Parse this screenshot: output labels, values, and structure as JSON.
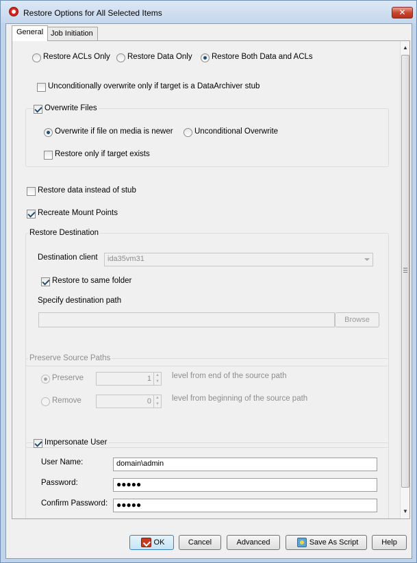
{
  "window": {
    "title": "Restore Options for All Selected Items",
    "close_glyph": "✕"
  },
  "tabs": [
    {
      "label": "General",
      "active": true
    },
    {
      "label": "Job Initiation",
      "active": false
    }
  ],
  "restore_mode": {
    "options": [
      "Restore ACLs Only",
      "Restore Data Only",
      "Restore Both Data and ACLs"
    ],
    "selected": "Restore Both Data and ACLs"
  },
  "unconditional_stub": {
    "label": "Unconditionally overwrite only if target is a DataArchiver stub",
    "checked": false
  },
  "overwrite_files": {
    "label": "Overwrite Files",
    "checked": true,
    "options": [
      "Overwrite if file on media is newer",
      "Unconditional Overwrite"
    ],
    "selected": "Overwrite if file on media is newer",
    "restore_if_exists": {
      "label": "Restore only if target exists",
      "checked": false
    }
  },
  "restore_data_instead_of_stub": {
    "label": "Restore data instead of stub",
    "checked": false
  },
  "recreate_mount_points": {
    "label": "Recreate Mount Points",
    "checked": true
  },
  "destination": {
    "group_label": "Restore Destination",
    "client_label": "Destination client",
    "client_value": "ida35vm31",
    "same_folder": {
      "label": "Restore to same folder",
      "checked": true
    },
    "path_label": "Specify destination path",
    "path_value": "",
    "browse_label": "Browse"
  },
  "preserve_paths": {
    "group_label": "Preserve Source Paths",
    "preserve": {
      "label": "Preserve",
      "value": "1",
      "desc": "level from end of the source path",
      "selected": true
    },
    "remove": {
      "label": "Remove",
      "value": "0",
      "desc": "level from beginning of the source path",
      "selected": false
    }
  },
  "impersonate": {
    "label": "Impersonate User",
    "checked": true,
    "username_label": "User Name:",
    "username_value": "domain\\admin",
    "password_label": "Password:",
    "password_value": "●●●●●",
    "confirm_label": "Confirm Password:",
    "confirm_value": "●●●●●"
  },
  "buttons": {
    "ok": "OK",
    "cancel": "Cancel",
    "advanced": "Advanced",
    "save_script": "Save As Script",
    "help": "Help"
  },
  "icons": {
    "app": "app-logo-icon",
    "ok": "ok-icon",
    "save_script": "save-script-icon",
    "scroll_up": "scroll-up-icon",
    "scroll_down": "scroll-down-icon"
  },
  "colors": {
    "title_bar": "#c5d7ec",
    "close_button": "#c9452f",
    "panel": "#f0f0f0"
  }
}
